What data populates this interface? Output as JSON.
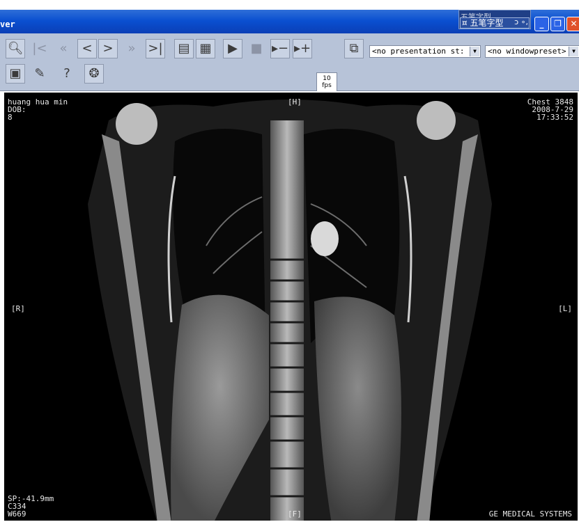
{
  "window": {
    "title_fragment": "ver",
    "ime": {
      "top_text": "五笔字型",
      "main_label": "五笔字型",
      "extra": "ɔ ∘,"
    },
    "buttons": {
      "minimize": "_",
      "maximize": "❐",
      "close": "✕"
    }
  },
  "toolbar": {
    "fps_value": "10",
    "fps_unit": "fps",
    "presentation_select": "<no presentation st:",
    "window_preset_select": "<no windowpreset>"
  },
  "viewer": {
    "patient_name": "huang hua min",
    "dob_label": "DOB:",
    "patient_field_3": "8",
    "study": "Chest 3848",
    "date": "2008-7-29",
    "time": "17:33:52",
    "orientation_top": "[H]",
    "orientation_left": "[R]",
    "orientation_right": "[L]",
    "orientation_bottom": "[F]",
    "sp": "SP:-41.9mm",
    "window_center": "C334",
    "window_width": "W669",
    "vendor": "GE MEDICAL SYSTEMS"
  }
}
